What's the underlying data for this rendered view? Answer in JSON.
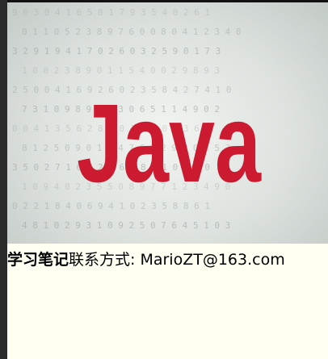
{
  "hero_image": {
    "word": "Java",
    "word_color": "#cc1a30",
    "digit_rows": [
      "9 0 3 0 4 1 6 5 8 1 7 9 3 5 4 0 2 6 1",
      "0 1 1 0 5 2 3 8 9 7 6 0 0 8 0 4 1 2 3 4 0",
      "3 2 9 1 9 4 1 7 0 2 6 0 3 2 5 9 0 1 7 3",
      "1 0 0 2 3 8 9 0 1 1 5 4 0 0 2 9 8 9 3",
      "2 5 0 0 4 1 6 9 2 6 0 2 3 5 8 4 2 7 4 1 0",
      "7 3 1 0 9 8 9 0 2 3 0 6 5 1 1 4 9 0 2",
      "0 0 4 1 3 5 6 2 8 7 0 1 4 2 0 9 3 6 8",
      "8 1 2 5 0 9 0 1 1 4 7 6 3 2 9 0 0 1 5 3",
      "3 5 0 2 7 1 6 0 2 9 6 2 8 4 1 0 1 2 0",
      "1 0 9 4 0 2 3 5 5 0 8 9 7 7 1 2 3 4 9 0",
      "0 2 2 1 8 4 0 6 9 4 1 0 2 3 5 8 8 6 1",
      "4 8 1 0 2 9 3 1 0 9 2 5 0 7 6 4 5 1 0 3"
    ]
  },
  "caption": {
    "bold_label": "学习笔记",
    "contact_text": "联系方式: MarioZT@163.com"
  }
}
